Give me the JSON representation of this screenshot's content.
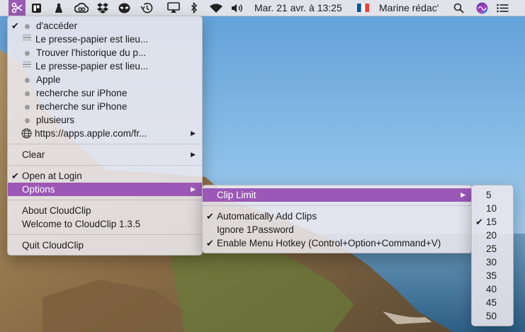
{
  "menubar": {
    "clock": "Mar. 21 avr. à  13:25",
    "user_name": "Marine rédac'",
    "flag_colors": [
      "#0055a4",
      "#ffffff",
      "#ef4135"
    ],
    "icons": [
      "cloudclip-scissors-icon",
      "bookmark-app-icon",
      "flask-icon",
      "creative-cloud-icon",
      "dropbox-icon",
      "alien-icon",
      "time-machine-icon",
      "airplay-icon",
      "bluetooth-icon",
      "wifi-icon",
      "volume-icon",
      "spotlight-search-icon",
      "siri-icon",
      "control-list-icon"
    ]
  },
  "clip_menu": {
    "recent_clips": [
      {
        "text": "d'accéder",
        "checked": true,
        "icon": "dot"
      },
      {
        "text": "Le presse-papier est lieu...",
        "checked": false,
        "icon": "lines"
      },
      {
        "text": "Trouver l'historique du p...",
        "checked": false,
        "icon": "dot"
      },
      {
        "text": "Le presse-papier est lieu...",
        "checked": false,
        "icon": "lines"
      },
      {
        "text": "Apple",
        "checked": false,
        "icon": "dot"
      },
      {
        "text": "recherche sur iPhone",
        "checked": false,
        "icon": "dot"
      },
      {
        "text": "recherche sur iPhone",
        "checked": false,
        "icon": "dot"
      },
      {
        "text": "plusieurs",
        "checked": false,
        "icon": "dot"
      },
      {
        "text": "https://apps.apple.com/fr...",
        "checked": false,
        "icon": "globe",
        "submenu": true
      }
    ],
    "clear_label": "Clear",
    "open_at_login_label": "Open at Login",
    "options_label": "Options",
    "about_label": "About CloudClip",
    "welcome_label": "Welcome to CloudClip 1.3.5",
    "quit_label": "Quit CloudClip"
  },
  "options_menu": {
    "clip_limit_label": "Clip Limit",
    "auto_add_label": "Automatically Add Clips",
    "ignore_1password_label": "Ignore 1Password",
    "hotkey_label": "Enable Menu Hotkey (Control+Option+Command+V)"
  },
  "clip_limit_menu": {
    "options": [
      "5",
      "10",
      "15",
      "20",
      "25",
      "30",
      "35",
      "40",
      "45",
      "50"
    ],
    "selected": "15"
  },
  "colors": {
    "highlight": "#9b58b6",
    "menubar_active": "#9a5ab3"
  }
}
